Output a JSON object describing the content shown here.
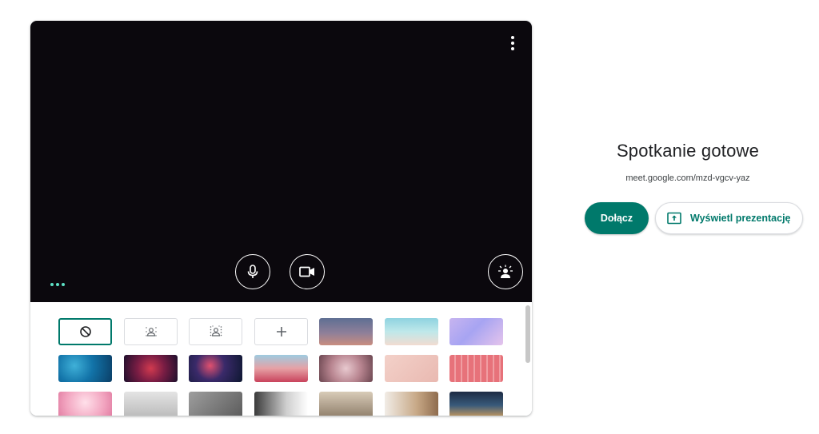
{
  "meeting": {
    "title": "Spotkanie gotowe",
    "url": "meet.google.com/mzd-vgcv-yaz",
    "join_label": "Dołącz",
    "present_label": "Wyświetl prezentację"
  },
  "preview": {
    "controls": [
      "more-options-icon",
      "microphone-icon",
      "camera-icon",
      "visual-effects-icon"
    ]
  },
  "backgrounds": {
    "options": [
      "no-effect-icon",
      "slight-blur-icon",
      "blur-icon",
      "add-icon"
    ],
    "selected": "no-effect",
    "colors": {
      "accent": "#00796b",
      "video_bg": "#0b080d"
    }
  }
}
